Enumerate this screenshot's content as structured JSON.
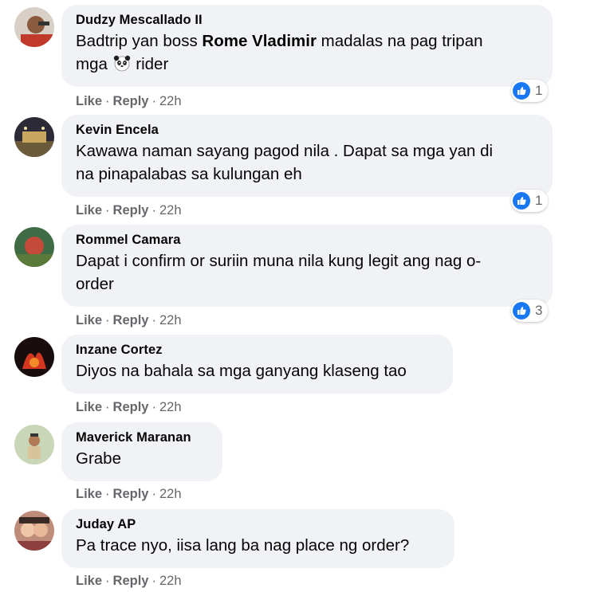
{
  "comments": [
    {
      "author": "Dudzy Mescallado II",
      "text_before": "Badtrip yan boss ",
      "mention": "Rome Vladimir",
      "text_after_line1": " madalas na pag tripan",
      "text_line2_before": "mga ",
      "emoji": "panda-face-icon",
      "text_line2_after": " rider",
      "actions": {
        "like": "Like",
        "reply": "Reply",
        "time": "22h"
      },
      "reactions": "1"
    },
    {
      "author": "Kevin Encela",
      "text_line1": "Kawawa naman sayang pagod nila . Dapat sa mga yan di",
      "text_line2": "na pinapalabas sa kulungan eh",
      "actions": {
        "like": "Like",
        "reply": "Reply",
        "time": "22h"
      },
      "reactions": "1"
    },
    {
      "author": "Rommel Camara",
      "text_line1": "Dapat i confirm or suriin muna nila kung legit ang nag o-",
      "text_line2": "order",
      "actions": {
        "like": "Like",
        "reply": "Reply",
        "time": "22h"
      },
      "reactions": "3"
    },
    {
      "author": "Inzane Cortez",
      "text": "Diyos na bahala sa mga ganyang klaseng tao",
      "actions": {
        "like": "Like",
        "reply": "Reply",
        "time": "22h"
      }
    },
    {
      "author": "Maverick Maranan",
      "text": "Grabe",
      "actions": {
        "like": "Like",
        "reply": "Reply",
        "time": "22h"
      }
    },
    {
      "author": "Juday AP",
      "text": "Pa trace nyo, iisa lang ba nag place ng order?",
      "actions": {
        "like": "Like",
        "reply": "Reply",
        "time": "22h"
      }
    }
  ],
  "colors": {
    "bubble": "#f0f2f5",
    "meta_text": "#65676b",
    "like_blue": "#1877f2"
  },
  "icons": {
    "reaction": "like-thumb-icon",
    "avatar": "user-avatar"
  }
}
